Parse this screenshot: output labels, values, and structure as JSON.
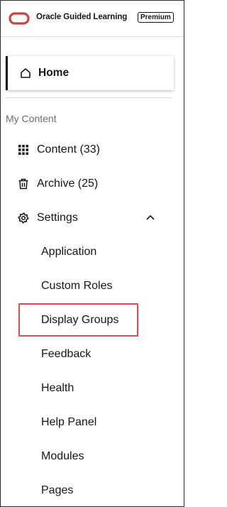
{
  "header": {
    "brand": "Oracle Guided Learning",
    "badge": "Premium",
    "logo_color": "#c74634"
  },
  "home": {
    "label": "Home",
    "icon": "home-icon"
  },
  "section_label": "My Content",
  "nav": {
    "content": {
      "label": "Content (33)",
      "icon": "grid-icon"
    },
    "archive": {
      "label": "Archive (25)",
      "icon": "trash-icon"
    },
    "settings": {
      "label": "Settings",
      "icon": "gear-icon",
      "expanded": true
    }
  },
  "settings_items": [
    {
      "label": "Application"
    },
    {
      "label": "Custom Roles"
    },
    {
      "label": "Display Groups",
      "highlighted": true
    },
    {
      "label": "Feedback"
    },
    {
      "label": "Health"
    },
    {
      "label": "Help Panel"
    },
    {
      "label": "Modules"
    },
    {
      "label": "Pages"
    }
  ],
  "colors": {
    "text": "#161513",
    "muted": "#6f6b66",
    "highlight": "#e34b4b"
  }
}
